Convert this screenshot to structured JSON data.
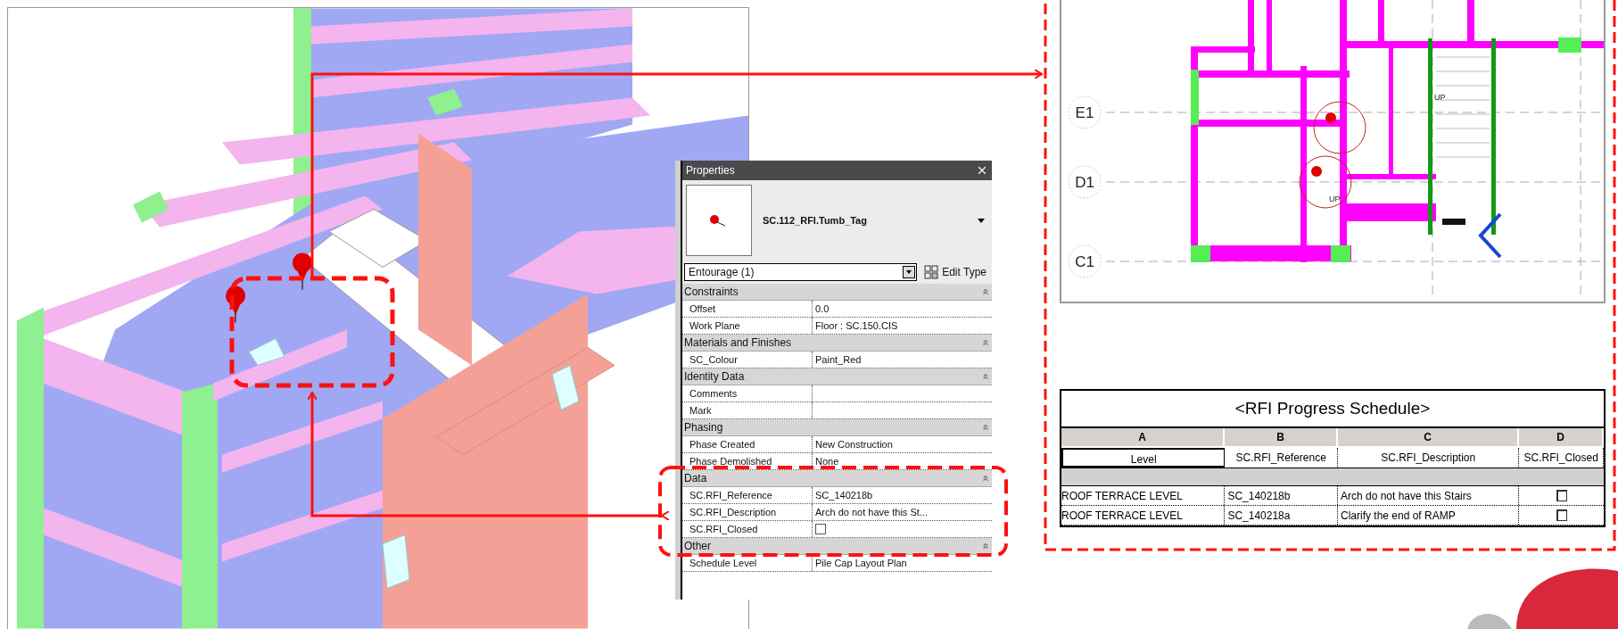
{
  "properties": {
    "title": "Properties",
    "type_name": "SC.112_RFI.Tumb_Tag",
    "selector": "Entourage (1)",
    "edit_type": "Edit Type",
    "sections": [
      {
        "name": "Constraints",
        "expanded": true,
        "rows": [
          {
            "label": "Offset",
            "value": "0.0",
            "kind": "text"
          },
          {
            "label": "Work Plane",
            "value": "Floor : SC.150.CIS",
            "kind": "text"
          }
        ]
      },
      {
        "name": "Materials and Finishes",
        "expanded": true,
        "rows": [
          {
            "label": "SC_Colour",
            "value": "Paint_Red",
            "kind": "text"
          }
        ]
      },
      {
        "name": "Identity Data",
        "expanded": true,
        "rows": [
          {
            "label": "Comments",
            "kind": "text"
          },
          {
            "label": "Mark",
            "kind": "text"
          }
        ]
      },
      {
        "name": "Phasing",
        "expanded": true,
        "rows": [
          {
            "label": "Phase Created",
            "value": "New Construction",
            "kind": "text"
          },
          {
            "label": "Phase Demolished",
            "value": "None",
            "kind": "text"
          }
        ]
      },
      {
        "name": "Data",
        "expanded": true,
        "rows": [
          {
            "label": "SC.RFI_Reference",
            "value": "SC_140218b",
            "kind": "text"
          },
          {
            "label": "SC.RFI_Description",
            "value": "Arch do not have this St...",
            "kind": "text"
          },
          {
            "label": "SC.RFI_Closed",
            "kind": "checkbox",
            "checked": false
          }
        ]
      },
      {
        "name": "Other",
        "expanded": true,
        "rows": [
          {
            "label": "Schedule Level",
            "value": "Pile Cap Layout Plan",
            "kind": "text"
          }
        ]
      }
    ]
  },
  "floor_plan": {
    "grid_labels": [
      "E1",
      "D1",
      "C1"
    ],
    "stair_labels": [
      "UP",
      "UP"
    ]
  },
  "schedule": {
    "title": "<RFI Progress Schedule>",
    "column_letters": [
      "A",
      "B",
      "C",
      "D"
    ],
    "columns": [
      "Level",
      "SC.RFI_Reference",
      "SC.RFI_Description",
      "SC.RFI_Closed"
    ],
    "rows": [
      {
        "level": "ROOF TERRACE LEVEL",
        "reference": "SC_140218b",
        "description": "Arch do not have this Stairs",
        "closed": false
      },
      {
        "level": "ROOF TERRACE LEVEL",
        "reference": "SC_140218a",
        "description": "Clarify the end of RAMP",
        "closed": false
      }
    ]
  }
}
